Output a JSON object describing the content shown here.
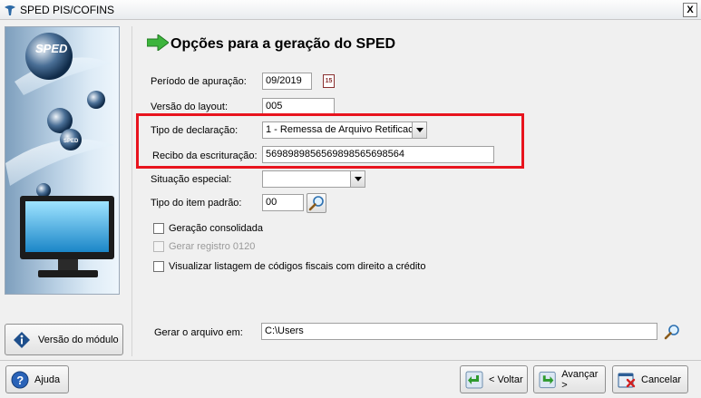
{
  "window": {
    "title": "SPED PIS/COFINS",
    "close_glyph": "X"
  },
  "sidebar": {
    "logo_text": "SPED",
    "sphere_text": "SPED",
    "module_button": {
      "label": "Versão do módulo",
      "icon": "info-icon"
    }
  },
  "main": {
    "heading": "Opções para a geração do SPED",
    "fields": {
      "periodo": {
        "label": "Período de apuração:",
        "value": "09/2019",
        "calendar_glyph": "15"
      },
      "versao_layout": {
        "label": "Versão do layout:",
        "value": "005"
      },
      "tipo_declaracao": {
        "label": "Tipo de declaração:",
        "value": "1 - Remessa de Arquivo Retificac"
      },
      "recibo": {
        "label": "Recibo da escrituração:",
        "value": "569898985656989856569856­4"
      },
      "situacao_especial": {
        "label": "Situação especial:",
        "value": ""
      },
      "tipo_item": {
        "label": "Tipo do item padrão:",
        "value": "00"
      },
      "gerar_em": {
        "label": "Gerar o arquivo em:",
        "value": "C:\\Users"
      }
    },
    "checkboxes": [
      {
        "label": "Geração consolidada",
        "checked": false,
        "enabled": true
      },
      {
        "label": "Gerar registro 0120",
        "checked": false,
        "enabled": false
      },
      {
        "label": "Visualizar listagem de códigos fiscais com direito a crédito",
        "checked": false,
        "enabled": true
      }
    ]
  },
  "footer": {
    "help": {
      "label": "Ajuda"
    },
    "back": {
      "label": "< Voltar"
    },
    "next": {
      "label": "Avançar >"
    },
    "cancel": {
      "label": "Cancelar"
    }
  },
  "colors": {
    "highlight_box": "#e8141e",
    "arrow_green": "#3cb43c"
  }
}
